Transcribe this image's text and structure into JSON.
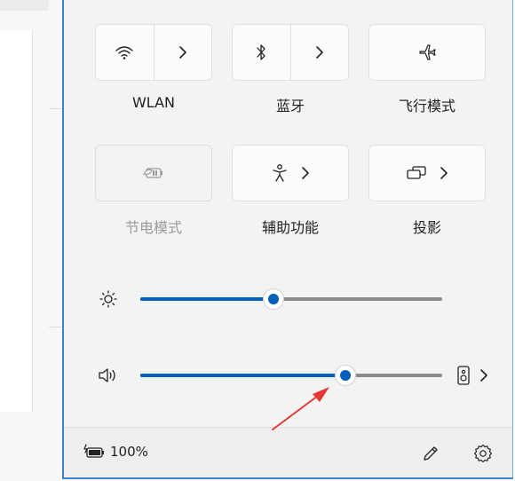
{
  "tiles": {
    "wlan": {
      "label": "WLAN"
    },
    "bluetooth": {
      "label": "蓝牙"
    },
    "airplane": {
      "label": "飞行模式"
    },
    "battery_saver": {
      "label": "节电模式"
    },
    "accessibility": {
      "label": "辅助功能"
    },
    "project": {
      "label": "投影"
    }
  },
  "sliders": {
    "brightness": {
      "level_percent": 44
    },
    "volume": {
      "level_percent": 68
    }
  },
  "footer": {
    "battery_text": "100%"
  },
  "colors": {
    "accent": "#005fb8",
    "annotation_arrow": "#e53935",
    "panel_background": "#f3f3f3"
  },
  "icons": [
    "wifi-icon",
    "bluetooth-icon",
    "airplane-icon",
    "battery-saver-icon",
    "accessibility-icon",
    "project-icon",
    "brightness-icon",
    "speaker-icon",
    "audio-output-icon",
    "battery-icon",
    "pencil-icon",
    "gear-icon",
    "chevron-right-icon"
  ]
}
